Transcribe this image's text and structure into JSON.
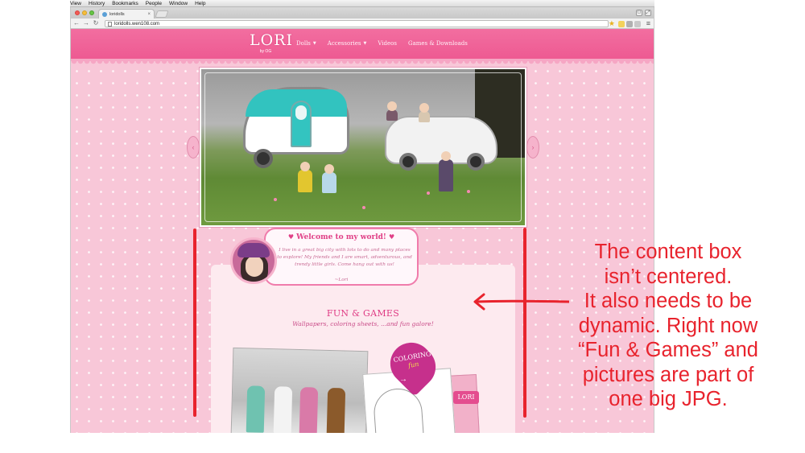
{
  "menubar": {
    "items": [
      "View",
      "History",
      "Bookmarks",
      "People",
      "Window",
      "Help"
    ]
  },
  "browser": {
    "tab_title": "loridolls",
    "url": "loridolls.wen108.com"
  },
  "site": {
    "logo": "LORI",
    "logo_sub": "by OG",
    "nav": [
      {
        "label": "Dolls",
        "has_dropdown": true
      },
      {
        "label": "Accessories",
        "has_dropdown": true
      },
      {
        "label": "Videos",
        "has_dropdown": false
      },
      {
        "label": "Games & Downloads",
        "has_dropdown": false
      }
    ],
    "welcome": {
      "title": "Welcome to my world!",
      "body": "I live in a great big city with lots to do and many places to explore! My friends and I are smart, adventurous, and trendy little girls. Come hang out with us!",
      "signature": "~Lori"
    },
    "fun": {
      "title": "FUN & GAMES",
      "subtitle": "Wallpapers, coloring sheets, ...and fun galore!"
    },
    "coloring_card": {
      "line1": "COLORING",
      "line2": "fun",
      "mini_logo": "LORI"
    }
  },
  "annotation": {
    "color": "#e8232d",
    "lines": [
      "The content box",
      "isn’t centered.",
      "It also needs to be",
      "dynamic. Right now",
      "“Fun & Games” and",
      "pictures are part of",
      "one big JPG."
    ]
  },
  "colors": {
    "nav_pink": "#ee5a92",
    "page_pink": "#f8c7d8",
    "accent_pink": "#e03f86",
    "annotation_red": "#e8232d"
  }
}
